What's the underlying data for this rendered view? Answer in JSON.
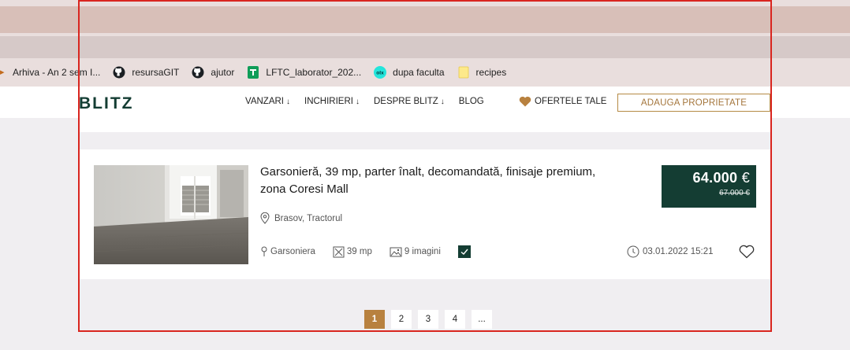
{
  "bookmarks": [
    {
      "label": "Arhiva - An 2 sem I...",
      "icon": "arrow-icon"
    },
    {
      "label": "resursaGIT",
      "icon": "github-icon"
    },
    {
      "label": "ajutor",
      "icon": "github-icon"
    },
    {
      "label": "LFTC_laborator_202...",
      "icon": "sheets-icon"
    },
    {
      "label": "dupa faculta",
      "icon": "olx-icon"
    },
    {
      "label": "recipes",
      "icon": "folder-icon"
    }
  ],
  "header": {
    "logo": "BLITZ",
    "nav": [
      {
        "label": "VANZARI",
        "arrow": "↓"
      },
      {
        "label": "INCHIRIERI",
        "arrow": "↓"
      },
      {
        "label": "DESPRE BLITZ",
        "arrow": "↓"
      },
      {
        "label": "BLOG",
        "arrow": ""
      }
    ],
    "offers_label": "OFERTELE TALE",
    "add_button": "ADAUGA PROPRIETATE"
  },
  "listing": {
    "title": "Garsonieră, 39 mp, parter înalt, decomandată, finisaje premium, zona Coresi Mall",
    "location": "Brasov, Tractorul",
    "price": "64.000",
    "currency": "€",
    "old_price": "67.000 €",
    "type": "Garsoniera",
    "area": "39 mp",
    "images": "9 imagini",
    "date": "03.01.2022 15:21"
  },
  "pagination": [
    "1",
    "2",
    "3",
    "4",
    "..."
  ],
  "colors": {
    "brand_dark": "#143d33",
    "accent_gold": "#b8813f",
    "frame_red": "#d9251f"
  }
}
